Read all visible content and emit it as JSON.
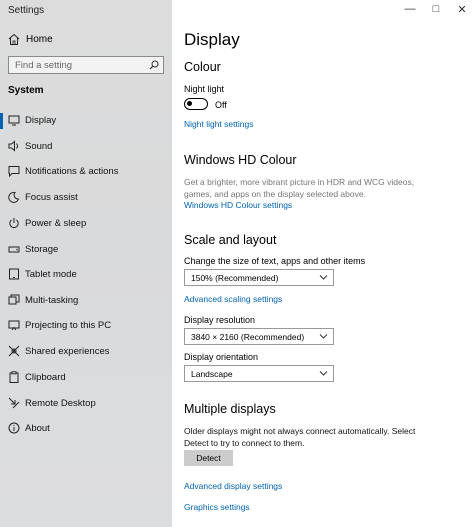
{
  "window": {
    "title": "Settings"
  },
  "sidebar": {
    "home_label": "Home",
    "search_placeholder": "Find a setting",
    "section_label": "System",
    "items": [
      {
        "label": "Display",
        "icon": "monitor-icon",
        "selected": true
      },
      {
        "label": "Sound",
        "icon": "speaker-icon"
      },
      {
        "label": "Notifications & actions",
        "icon": "message-icon"
      },
      {
        "label": "Focus assist",
        "icon": "moon-icon"
      },
      {
        "label": "Power & sleep",
        "icon": "power-icon"
      },
      {
        "label": "Storage",
        "icon": "drive-icon"
      },
      {
        "label": "Tablet mode",
        "icon": "tablet-icon"
      },
      {
        "label": "Multi-tasking",
        "icon": "multitask-icon"
      },
      {
        "label": "Projecting to this PC",
        "icon": "project-icon"
      },
      {
        "label": "Shared experiences",
        "icon": "shared-icon"
      },
      {
        "label": "Clipboard",
        "icon": "clipboard-icon"
      },
      {
        "label": "Remote Desktop",
        "icon": "remote-icon"
      },
      {
        "label": "About",
        "icon": "info-icon"
      }
    ]
  },
  "main": {
    "title": "Display",
    "colour": {
      "heading": "Colour",
      "night_light_label": "Night light",
      "night_light_state": "Off",
      "night_light_link": "Night light settings"
    },
    "hd": {
      "heading": "Windows HD Colour",
      "description": "Get a brighter, more vibrant picture in HDR and WCG videos, games, and apps on the display selected above.",
      "link": "Windows HD Colour settings"
    },
    "scale": {
      "heading": "Scale and layout",
      "size_label": "Change the size of text, apps and other items",
      "size_value": "150% (Recommended)",
      "advanced_link": "Advanced scaling settings",
      "resolution_label": "Display resolution",
      "resolution_value": "3840 × 2160 (Recommended)",
      "orientation_label": "Display orientation",
      "orientation_value": "Landscape"
    },
    "multiple": {
      "heading": "Multiple displays",
      "description": "Older displays might not always connect automatically. Select Detect to try to connect to them.",
      "detect_button": "Detect",
      "advanced_link": "Advanced display settings",
      "graphics_link": "Graphics settings"
    }
  },
  "colors": {
    "accent": "#0063b1",
    "sidebar_bg": "#dadbdc"
  }
}
